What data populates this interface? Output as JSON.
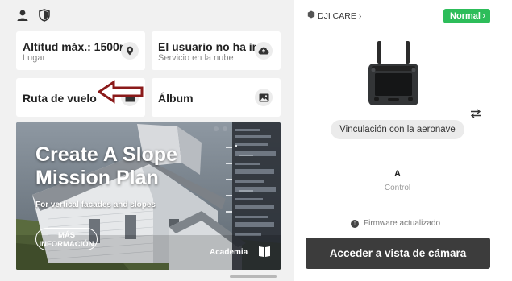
{
  "top_icons": [
    "user-icon",
    "shield-icon"
  ],
  "cards": {
    "altitude": {
      "title": "Altitud máx.: 1500m",
      "subtitle": "Lugar",
      "icon": "location-pin-icon"
    },
    "user": {
      "title": "El usuario no ha in",
      "subtitle": "Servicio en la nube",
      "icon": "cloud-icon"
    },
    "flight_route": {
      "title": "Ruta de vuelo",
      "icon": "folder-icon"
    },
    "album": {
      "title": "Álbum",
      "icon": "image-icon"
    }
  },
  "banner": {
    "headline": "Create A Slope\nMission Plan",
    "subtitle": "For vertical facades and slopes",
    "more_button": "MÁS\nINFORMACIÓN",
    "academy": "Academia",
    "academy_icon": "book-icon"
  },
  "right": {
    "dji_care": "DJI CARE",
    "status_button": "Normal",
    "link_button": "Vinculación con la aeronave",
    "controller_letter": "A",
    "controller_label": "Control",
    "firmware_text": "Firmware actualizado",
    "camera_button": "Acceder a vista de cámara"
  },
  "colors": {
    "accent_green": "#2dbd5a",
    "arrow_red": "#8b1a1a",
    "camera_button": "#3c3c3c"
  }
}
